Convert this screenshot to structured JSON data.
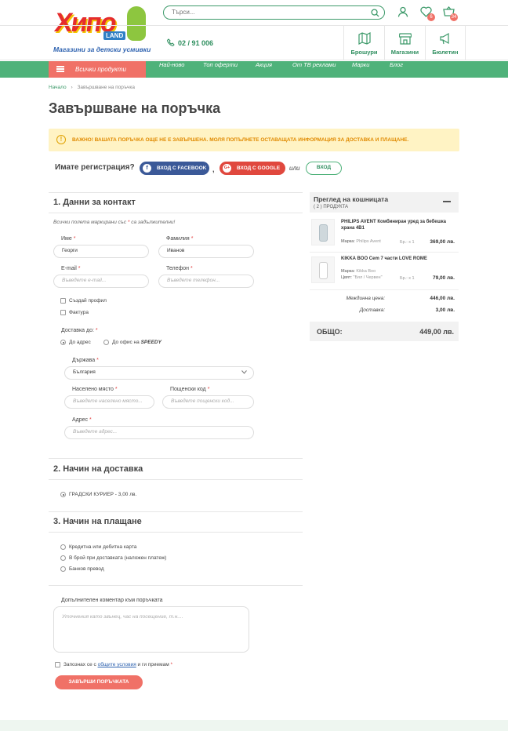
{
  "header": {
    "logo_text": "Хипо",
    "logo_sub": "LAND",
    "tagline": "Магазини за детски усмивки",
    "search_placeholder": "Търси...",
    "wishlist_count": "6",
    "cart_count": "34",
    "phone": "02 / 91 006",
    "tiles": [
      {
        "label": "Брошури",
        "icon": "map-icon"
      },
      {
        "label": "Магазини",
        "icon": "store-icon"
      },
      {
        "label": "Бюлетин",
        "icon": "megaphone-icon"
      }
    ]
  },
  "nav": {
    "all_products": "Всички продукти",
    "items": [
      "Най-ново",
      "Топ оферти",
      "Акция",
      "От ТВ реклами",
      "Марки",
      "Блог"
    ]
  },
  "breadcrumb": {
    "home": "Начало",
    "separator": "›",
    "current": "Завършване на поръчка"
  },
  "page_title": "Завършване на поръчка",
  "warning": "ВАЖНО! ВАШАТА ПОРЪЧКА ОЩЕ НЕ Е ЗАВЪРШЕНА. МОЛЯ ПОПЪЛНЕТЕ ОСТАВАЩАТА ИНФОРМАЦИЯ ЗА ДОСТАВКА И ПЛАЩАНЕ.",
  "registration": {
    "question": "Имате регистрация?",
    "facebook": "ВХОД С FACEBOOK",
    "comma": ",",
    "google": "ВХОД С GOOGLE",
    "or": "или",
    "login": "ВХОД"
  },
  "contact": {
    "heading": "1.  Данни за контакт",
    "note_prefix": "Всички полета маркирани със",
    "note_star": "*",
    "note_suffix": "са задължителни!",
    "first_name_label": "Име",
    "first_name_value": "Георги",
    "last_name_label": "Фамилия",
    "last_name_value": "Иванов",
    "email_label": "E-mail",
    "email_placeholder": "Въведете e-mail...",
    "phone_label": "Телефон",
    "phone_placeholder": "Въведете телефон...",
    "create_profile": "Създай профил",
    "invoice": "Фактура",
    "delivery_to_label": "Доставка до:",
    "delivery_address": "До адрес",
    "delivery_office": "До офис на",
    "delivery_office_brand": "SPEEDY",
    "country_label": "Държава",
    "country_value": "България",
    "city_label": "Населено място",
    "city_placeholder": "Въведете населено място...",
    "postcode_label": "Пощенски код",
    "postcode_placeholder": "Въведете пощенски код...",
    "address_label": "Адрес",
    "address_placeholder": "Въведете адрес...",
    "req": "*"
  },
  "shipping": {
    "heading": "2.  Начин на доставка",
    "option": "ГРАДСКИ КУРИЕР - 3,00 лв."
  },
  "payment": {
    "heading": "3.  Начин на плащане",
    "options": [
      "Кредитна или дебитна карта",
      "В брой при доставката (наложен платеж)",
      "Банков превод"
    ],
    "comment_label": "Допълнителен коментар към поръчката",
    "comment_placeholder": "Уточнения като звънец, час на посещение, т.н....",
    "terms_prefix": "Запознах се с",
    "terms_link": "общите условия",
    "terms_suffix": "и ги приемам",
    "submit": "ЗАВЪРШИ ПОРЪЧКАТА"
  },
  "cart": {
    "title": "Преглед на кошницата",
    "count_text": "( 2 )  ПРОДУКТА",
    "items": [
      {
        "name": "PHILIPS AVENT Комбиниран уред за бебешка храна 4В1",
        "brand_label": "Марка:",
        "brand": "Philips Avent",
        "qty": "Бр.: х 1",
        "price": "369,00 лв."
      },
      {
        "name": "KIKKA BOO Cem 7 части LOVE ROME",
        "brand_label": "Марка:",
        "brand": "Kikka Boo",
        "color_label": "Цвят:",
        "color": "\"Бял / Червен\"",
        "qty": "Бр.: х 1",
        "price": "79,00 лв."
      }
    ],
    "subtotal_label": "Междинна цена:",
    "subtotal": "446,00 лв.",
    "delivery_label": "Доставка:",
    "delivery": "3,00 лв.",
    "total_label": "ОБЩО:",
    "total": "449,00 лв."
  },
  "colors": {
    "green": "#4fb27a",
    "coral": "#f07167",
    "warning_bg": "#fff3c4"
  }
}
